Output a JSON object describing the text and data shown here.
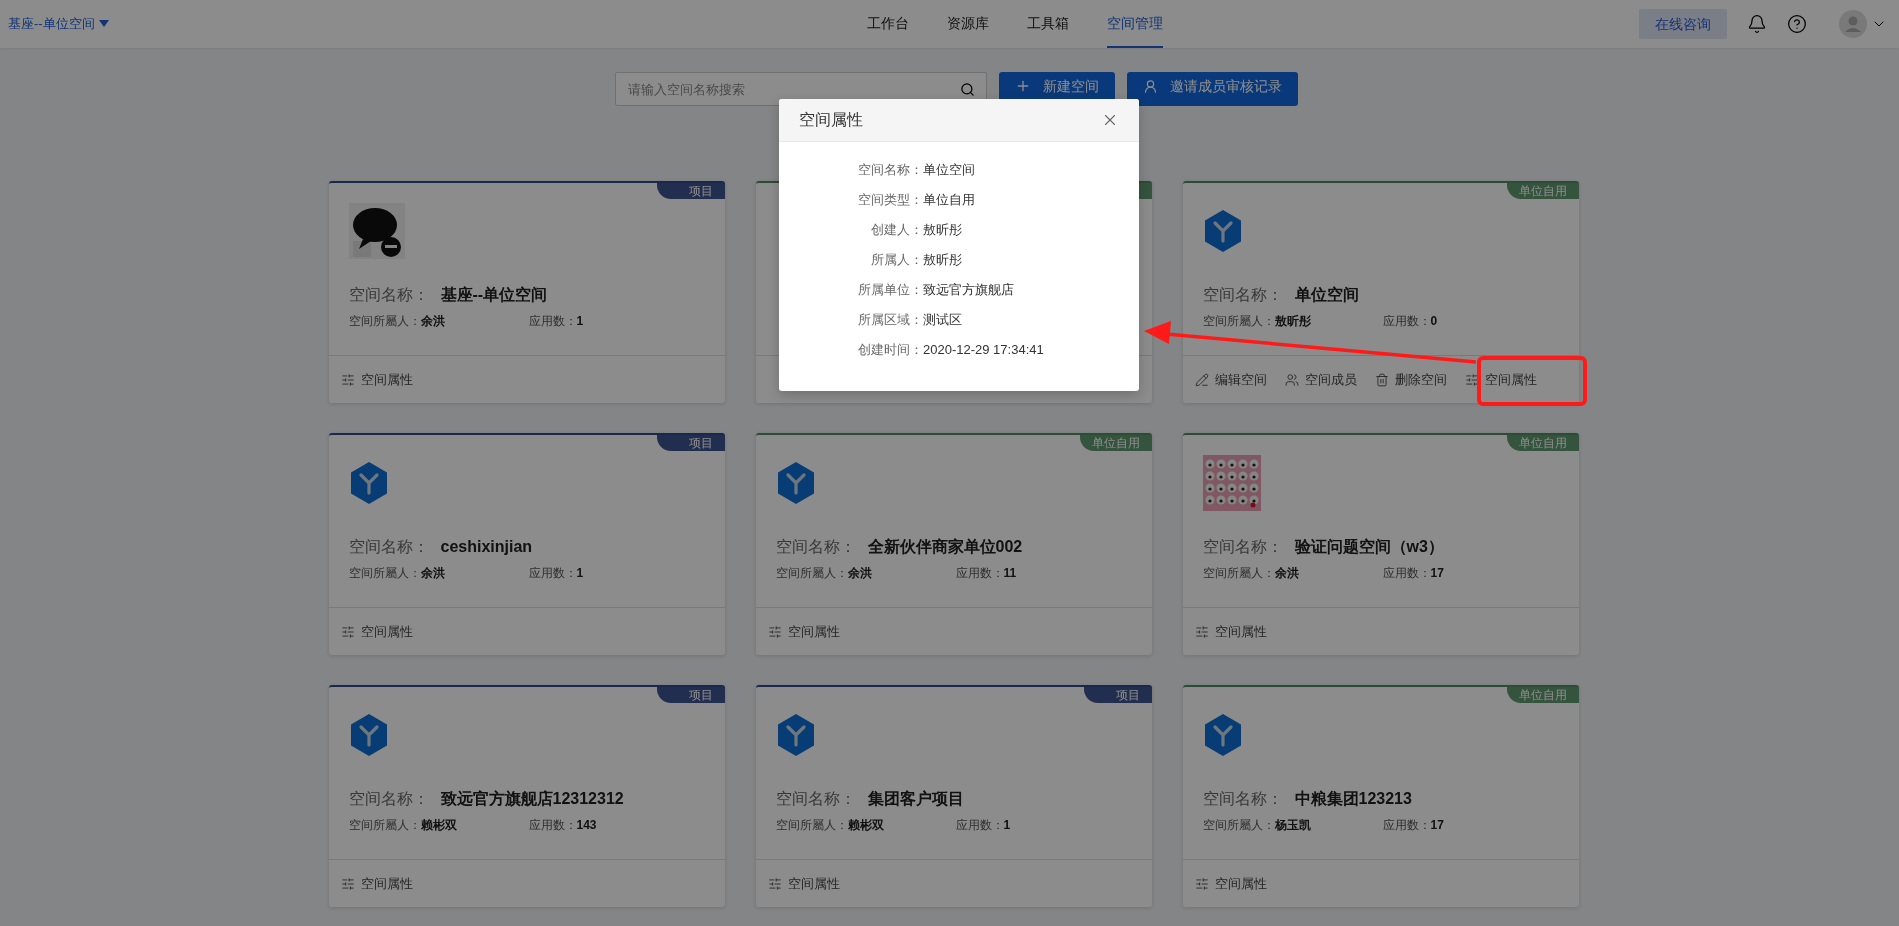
{
  "header": {
    "space_switcher": "基座--单位空间",
    "nav": [
      {
        "label": "工作台",
        "selected": false
      },
      {
        "label": "资源库",
        "selected": false
      },
      {
        "label": "工具箱",
        "selected": false
      },
      {
        "label": "空间管理",
        "selected": true
      }
    ],
    "consult_button": "在线咨询"
  },
  "toolbar": {
    "search": {
      "placeholder": "请输入空间名称搜索"
    },
    "buttons": [
      {
        "kind": "add",
        "label": "新建空间"
      },
      {
        "kind": "invite",
        "label": "邀请成员审核记录"
      }
    ]
  },
  "cards": [
    {
      "kind": "project",
      "tag": "项目",
      "logo": {
        "kind": "picture"
      },
      "name_label": "空间名称：",
      "name": "基座--单位空间",
      "owner_label": "空间所屬人：",
      "owner": "余洪",
      "apps_label": "应用数：",
      "apps": "1",
      "actions": [
        {
          "kind": "properties",
          "label": "空间属性"
        }
      ]
    },
    {
      "kind": "unit"
    },
    {
      "kind": "unit",
      "tag": "单位自用",
      "logo": {
        "kind": "hexagon"
      },
      "name_label": "空间名称：",
      "name": "单位空间",
      "owner_label": "空间所屬人：",
      "owner": "敖昕彤",
      "apps_label": "应用数：",
      "apps": "0",
      "actions": [
        {
          "kind": "edit",
          "label": "编辑空间"
        },
        {
          "kind": "members",
          "label": "空间成员"
        },
        {
          "kind": "delete",
          "label": "删除空间"
        },
        {
          "kind": "properties",
          "label": "空间属性"
        }
      ]
    },
    {
      "kind": "project",
      "tag": "项目",
      "logo": {
        "kind": "hexagon"
      },
      "name_label": "空间名称：",
      "name": "ceshixinjian",
      "owner_label": "空间所屬人：",
      "owner": "余洪",
      "apps_label": "应用数：",
      "apps": "1",
      "actions": [
        {
          "kind": "properties",
          "label": "空间属性"
        }
      ]
    },
    {
      "kind": "unit",
      "tag": "单位自用",
      "logo": {
        "kind": "hexagon"
      },
      "name_label": "空间名称：",
      "name": "全新伙伴商家单位002",
      "owner_label": "空间所屬人：",
      "owner": "余洪",
      "apps_label": "应用数：",
      "apps": "11",
      "actions": [
        {
          "kind": "properties",
          "label": "空间属性"
        }
      ]
    },
    {
      "kind": "unit",
      "tag": "单位自用",
      "logo": {
        "kind": "pattern"
      },
      "name_label": "空间名称：",
      "name": "验证问题空间（w3）",
      "owner_label": "空间所屬人：",
      "owner": "余洪",
      "apps_label": "应用数：",
      "apps": "17",
      "actions": [
        {
          "kind": "properties",
          "label": "空间属性"
        }
      ]
    },
    {
      "kind": "project",
      "tag": "项目",
      "logo": {
        "kind": "hexagon"
      },
      "name_label": "空间名称：",
      "name": "致远官方旗舰店12312312",
      "owner_label": "空间所屬人：",
      "owner": "赖彬双",
      "apps_label": "应用数：",
      "apps": "143",
      "actions": [
        {
          "kind": "properties",
          "label": "空间属性"
        }
      ]
    },
    {
      "kind": "project",
      "tag": "项目",
      "logo": {
        "kind": "hexagon"
      },
      "name_label": "空间名称：",
      "name": "集团客户项目",
      "owner_label": "空间所屬人：",
      "owner": "赖彬双",
      "apps_label": "应用数：",
      "apps": "1",
      "actions": [
        {
          "kind": "properties",
          "label": "空间属性"
        }
      ]
    },
    {
      "kind": "unit",
      "tag": "单位自用",
      "logo": {
        "kind": "hexagon"
      },
      "name_label": "空间名称：",
      "name": "中粮集团123213",
      "owner_label": "空间所屬人：",
      "owner": "杨玉凯",
      "apps_label": "应用数：",
      "apps": "17",
      "actions": [
        {
          "kind": "properties",
          "label": "空间属性"
        }
      ]
    }
  ],
  "dialog": {
    "title": "空间属性",
    "fields": [
      {
        "label": "空间名称：",
        "value": "单位空间"
      },
      {
        "label": "空间类型：",
        "value": "单位自用"
      },
      {
        "label": "创建人：",
        "value": "敖昕彤"
      },
      {
        "label": "所属人：",
        "value": "敖昕彤"
      },
      {
        "label": "所属单位：",
        "value": "致远官方旗舰店"
      },
      {
        "label": "所属区域：",
        "value": "测试区"
      },
      {
        "label": "创建时间：",
        "value": "2020-12-29 17:34:41"
      }
    ]
  }
}
